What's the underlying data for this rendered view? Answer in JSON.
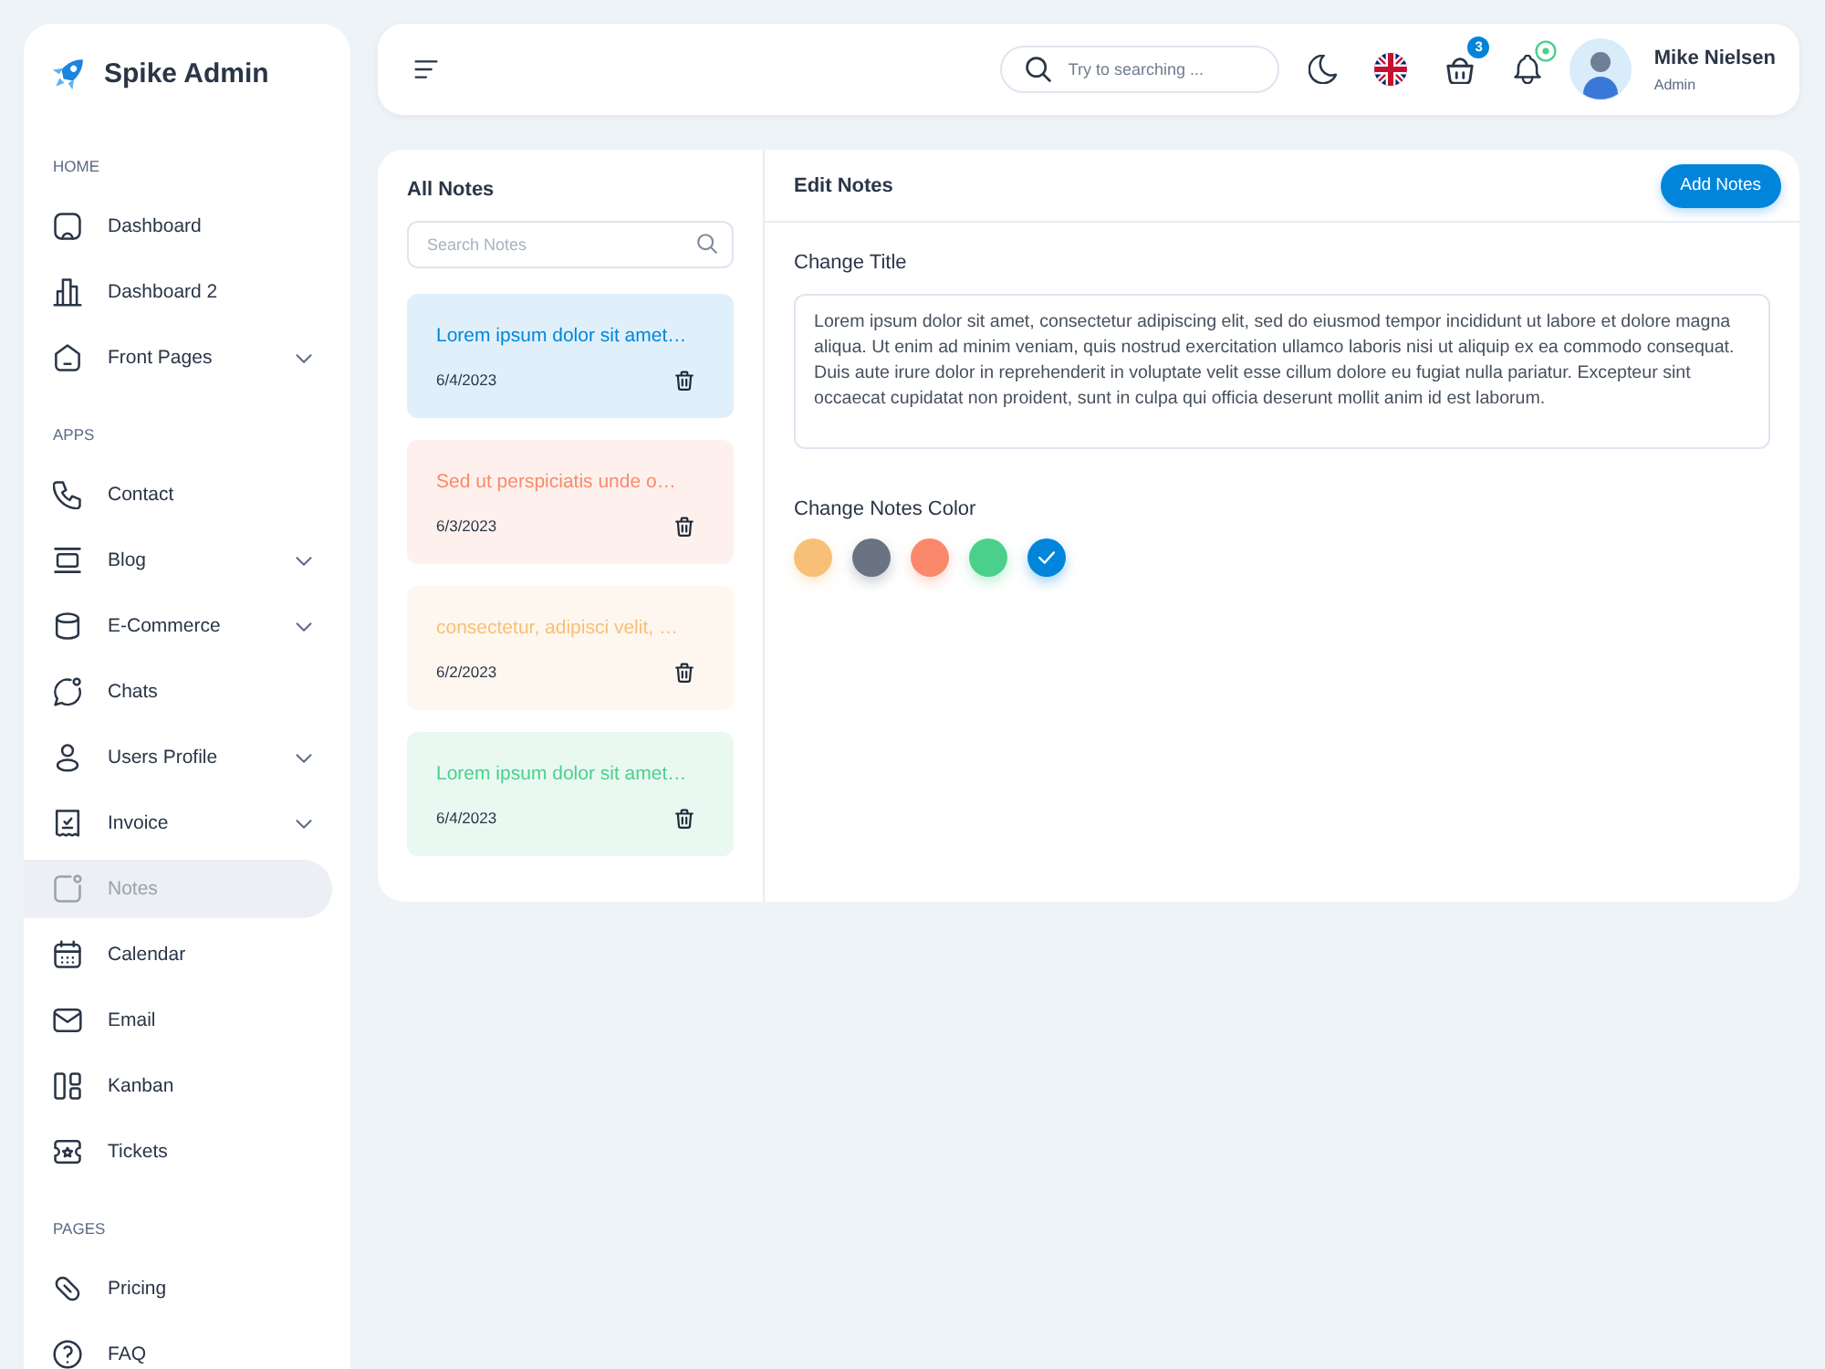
{
  "sidebar": {
    "logo": "Spike Admin",
    "sections": [
      {
        "title": "HOME",
        "items": [
          {
            "label": "Dashboard",
            "expandable": false,
            "selected": false
          },
          {
            "label": "Dashboard 2",
            "expandable": false,
            "selected": false
          },
          {
            "label": "Front Pages",
            "expandable": true,
            "selected": false
          }
        ]
      },
      {
        "title": "APPS",
        "items": [
          {
            "label": "Contact",
            "expandable": false,
            "selected": false
          },
          {
            "label": "Blog",
            "expandable": true,
            "selected": false
          },
          {
            "label": "E-Commerce",
            "expandable": true,
            "selected": false
          },
          {
            "label": "Chats",
            "expandable": false,
            "selected": false
          },
          {
            "label": "Users Profile",
            "expandable": true,
            "selected": false
          },
          {
            "label": "Invoice",
            "expandable": true,
            "selected": false
          },
          {
            "label": "Notes",
            "expandable": false,
            "selected": true
          },
          {
            "label": "Calendar",
            "expandable": false,
            "selected": false
          },
          {
            "label": "Email",
            "expandable": false,
            "selected": false
          },
          {
            "label": "Kanban",
            "expandable": false,
            "selected": false
          },
          {
            "label": "Tickets",
            "expandable": false,
            "selected": false
          }
        ]
      },
      {
        "title": "PAGES",
        "items": [
          {
            "label": "Pricing",
            "expandable": false,
            "selected": false
          },
          {
            "label": "FAQ",
            "expandable": false,
            "selected": false
          }
        ]
      }
    ]
  },
  "header": {
    "search": {
      "placeholder": "Try to searching ..."
    },
    "cart_count": "3",
    "notifications_unread": true,
    "user": {
      "name": "Mike Nielsen",
      "role": "Admin"
    }
  },
  "notes_list": {
    "title": "All Notes",
    "search": {
      "placeholder": "Search Notes"
    },
    "notes": [
      {
        "title": "Lorem ipsum dolor sit amet…",
        "date": "6/4/2023",
        "color": "#0085db"
      },
      {
        "title": "Sed ut perspiciatis unde o…",
        "date": "6/3/2023",
        "color": "#fa896b"
      },
      {
        "title": "consectetur, adipisci velit, …",
        "date": "6/2/2023",
        "color": "#f8c076"
      },
      {
        "title": "Lorem ipsum dolor sit amet…",
        "date": "6/4/2023",
        "color": "#4bd08b"
      }
    ]
  },
  "editor": {
    "title": "Edit Notes",
    "add_button": "Add Notes",
    "title_label": "Change Title",
    "note_text": "Lorem ipsum dolor sit amet, consectetur adipiscing elit, sed do eiusmod tempor incididunt ut labore et dolore magna aliqua. Ut enim ad minim veniam, quis nostrud exercitation ullamco laboris nisi ut aliquip ex ea commodo consequat. Duis aute irure dolor in reprehenderit in voluptate velit esse cillum dolore eu fugiat nulla pariatur. Excepteur sint occaecat cupidatat non proident, sunt in culpa qui officia deserunt mollit anim id est laborum.",
    "color_label": "Change Notes Color",
    "colors": [
      {
        "color": "#f8c076",
        "selected": false
      },
      {
        "color": "#6a7381",
        "selected": false
      },
      {
        "color": "#fa896b",
        "selected": false
      },
      {
        "color": "#4bd08b",
        "selected": false
      },
      {
        "color": "#0085db",
        "selected": true
      }
    ]
  }
}
